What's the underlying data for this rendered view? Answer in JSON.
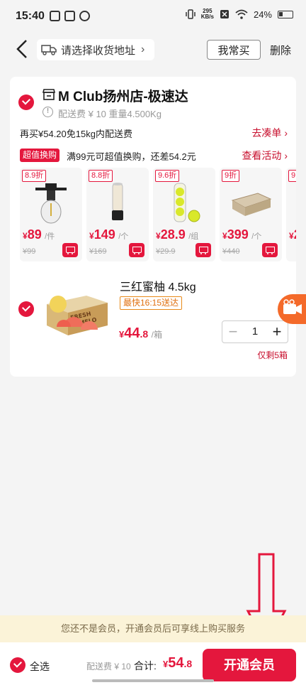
{
  "status_bar": {
    "time": "15:40",
    "net_speed_value": "295",
    "net_speed_unit": "KB/s",
    "battery": "24%"
  },
  "header": {
    "address_placeholder": "请选择收货地址",
    "often_buy_label": "我常买",
    "delete_label": "删除"
  },
  "store": {
    "name": "M Club扬州店-极速达",
    "delivery_info": "配送费 ¥ 10 重量4.500Kg",
    "free_shipping_text": "再买¥54.20免15kg内配送费",
    "go_order_label": "去凑单 ›",
    "exchange_tag": "超值换购",
    "exchange_text": "满99元可超值换购，还差54.2元",
    "view_activity_label": "查看活动 ›"
  },
  "exchange_products": [
    {
      "discount": "8.9折",
      "yen": "¥",
      "price": "89",
      "unit": "/件",
      "original": "¥99",
      "icon": "light-bulb"
    },
    {
      "discount": "8.8折",
      "yen": "¥",
      "price": "149",
      "unit": "/个",
      "original": "¥169",
      "icon": "flashlight"
    },
    {
      "discount": "9.6折",
      "yen": "¥",
      "price": "28.9",
      "unit": "/组",
      "original": "¥29.9",
      "icon": "tennis-balls"
    },
    {
      "discount": "9折",
      "yen": "¥",
      "price": "399",
      "unit": "/个",
      "original": "¥440",
      "icon": "air-mattress"
    },
    {
      "discount": "9",
      "yen": "¥",
      "price": "2",
      "unit": "",
      "original": "",
      "icon": "partial"
    }
  ],
  "cart_item": {
    "title": "三红蜜柚 4.5kg",
    "delivery_tag": "最快16:15送达",
    "price_yen": "¥",
    "price_int": "44",
    "price_dec": ".8",
    "unit": "/箱",
    "quantity": "1",
    "minus": "−",
    "plus": "+",
    "stock": "仅剩5箱",
    "image_words": [
      "FRESH",
      "POMELO"
    ]
  },
  "bottom": {
    "member_notice": "您还不是会员，开通会员后可享线上购买服务",
    "select_all_label": "全选",
    "delivery_fee": "配送费 ¥ 10",
    "total_label": "合计:",
    "total_yen": "¥",
    "total_int": "54",
    "total_dec": ".8",
    "open_member_label": "开通会员"
  },
  "colors": {
    "accent": "#e4173d",
    "orange": "#f46a2a",
    "notice_bg": "#fbf3d8"
  }
}
